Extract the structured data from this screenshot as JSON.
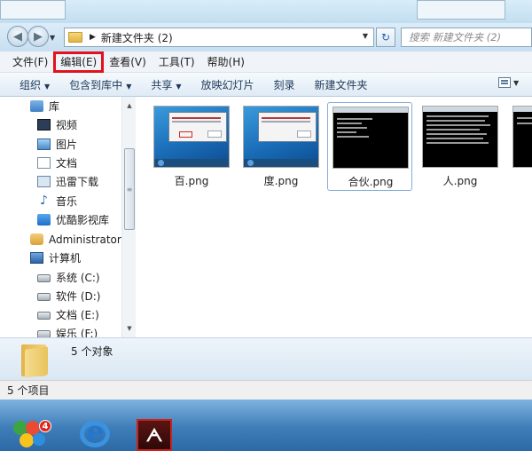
{
  "address_bar": {
    "path": "新建文件夹 (2)",
    "search_placeholder": "搜索 新建文件夹 (2)"
  },
  "menubar": {
    "items": [
      "文件(F)",
      "编辑(E)",
      "查看(V)",
      "工具(T)",
      "帮助(H)"
    ],
    "highlighted": "编辑(E)"
  },
  "toolbar": {
    "organize": "组织",
    "include_in_library": "包含到库中",
    "share": "共享",
    "slideshow": "放映幻灯片",
    "burn": "刻录",
    "new_folder": "新建文件夹"
  },
  "nav_pane": {
    "library": "库",
    "video": "视频",
    "pictures": "图片",
    "documents": "文档",
    "thunder": "迅雷下载",
    "music": "音乐",
    "youku": "优酷影视库",
    "user": "Administrator",
    "computer": "计算机",
    "drive_c": "系统 (C:)",
    "drive_d": "软件 (D:)",
    "drive_e": "文档 (E:)",
    "drive_f": "娱乐 (F:)"
  },
  "files": [
    {
      "name": "百.png",
      "thumb": "win7-dialog"
    },
    {
      "name": "度.png",
      "thumb": "win7-dialog"
    },
    {
      "name": "合伙.png",
      "thumb": "command-prompt",
      "selected": true
    },
    {
      "name": "人.png",
      "thumb": "command-prompt"
    }
  ],
  "details_pane": {
    "count": "5 个对象"
  },
  "status_bar": {
    "items": "5 个项目"
  },
  "taskbar": {
    "badge": "4",
    "icons": [
      "color-app-icon",
      "internet-explorer-icon",
      "acrobat-icon"
    ]
  },
  "colors": {
    "highlight": "#e3111d",
    "selection_border": "#84acdd",
    "taskbar": "#3e7db8"
  }
}
